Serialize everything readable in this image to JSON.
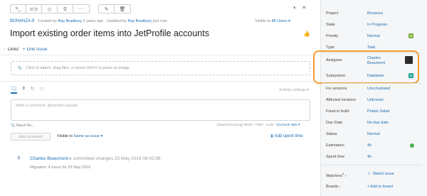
{
  "toolbar": {
    "group1": [
      {
        "icon": "command-icon",
        "glyph": ">_"
      },
      {
        "icon": "link-icon",
        "glyph": "⊂⊃"
      },
      {
        "icon": "tag-icon",
        "glyph": "◇"
      },
      {
        "icon": "user-icon",
        "glyph": "⚲"
      },
      {
        "icon": "more-icon",
        "glyph": "···"
      }
    ],
    "group2": [
      {
        "icon": "edit-icon",
        "glyph": "✎"
      },
      {
        "icon": "delete-icon",
        "glyph": "🗑"
      }
    ]
  },
  "issue": {
    "id": "BONANZA-9",
    "created_prefix": "Created by",
    "created_by": "Ray Bradbury",
    "created_when": "3 years ago",
    "updated_prefix": "Updated by",
    "updated_by": "Ray Bradbury",
    "updated_when": "just now",
    "visible_prefix": "Visible to",
    "visible_to": "All Users",
    "title": "Import existing order items into JetProfile accounts"
  },
  "links": {
    "label": "Links",
    "count": "1",
    "add": "+ Link issue"
  },
  "attach": {
    "placeholder": "Click to attach, drag files, or press Ctrl+V to paste an image"
  },
  "activity": {
    "settings": "Activity settings ▾",
    "comment_placeholder": "Write a comment, @mention people",
    "attach_file": "Attach file...",
    "markup_hint": "[attachment.png] *Bold* +Title+ `code`",
    "markup_link": "YouTrack Wiki",
    "add_comment": "Add comment",
    "visible_label": "Visible to",
    "visible_value": "Same as issue ▾",
    "add_spent_time": "Add spent time",
    "entry_author": "Charles Beaumont",
    "entry_text": "committed changes 25 May 2016 08:42:56",
    "entry_sub": "Migration: 4 hours for 23 May 2016"
  },
  "fields": [
    {
      "name": "Project",
      "value": "Bonanza"
    },
    {
      "name": "State",
      "value": "In Progress"
    },
    {
      "name": "Priority",
      "value": "Normal",
      "badge": "N",
      "color": "#7cb342"
    },
    {
      "name": "Type",
      "value": "Task"
    },
    {
      "name": "Assignee",
      "value": "Charles Beaumont"
    },
    {
      "name": "Subsystem",
      "value": "Database",
      "badge": "D",
      "color": "#26a69a"
    },
    {
      "name": "Fix versions",
      "value": "Unscheduled"
    },
    {
      "name": "Affected versions",
      "value": "Unknown"
    },
    {
      "name": "Fixed in build",
      "value": "Potato Salad"
    },
    {
      "name": "Due Date",
      "value": "No due date"
    },
    {
      "name": "Status",
      "value": "Normal"
    },
    {
      "name": "Estimation",
      "value": "4h"
    },
    {
      "name": "Spent time",
      "value": "4h"
    }
  ],
  "watchers": {
    "label": "Watchers",
    "count": "0",
    "action": "Watch issue"
  },
  "boards": {
    "label": "Boards",
    "action": "+ Add to board"
  }
}
